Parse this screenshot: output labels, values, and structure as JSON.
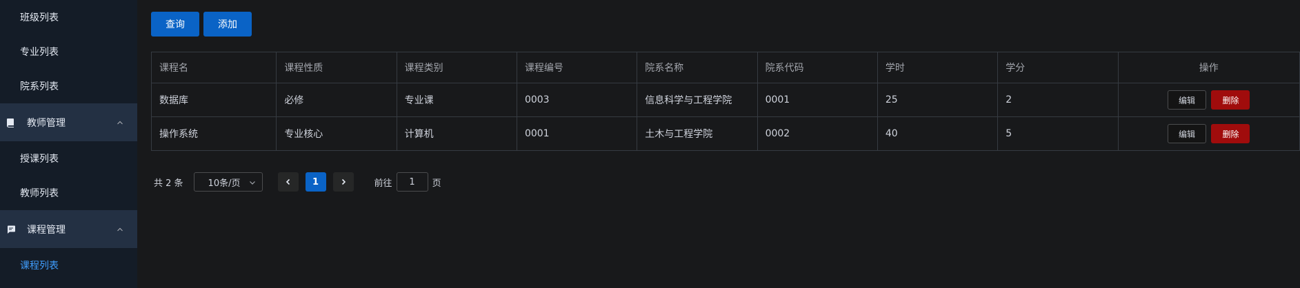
{
  "sidebar": {
    "items": [
      {
        "type": "sub",
        "label": "班级列表",
        "name": "sidebar-item-class-list"
      },
      {
        "type": "sub",
        "label": "专业列表",
        "name": "sidebar-item-major-list"
      },
      {
        "type": "sub",
        "label": "院系列表",
        "name": "sidebar-item-department-list"
      },
      {
        "type": "group",
        "label": "教师管理",
        "icon": "book-icon",
        "name": "sidebar-group-teacher-management"
      },
      {
        "type": "sub",
        "label": "授课列表",
        "name": "sidebar-item-teaching-list"
      },
      {
        "type": "sub",
        "label": "教师列表",
        "name": "sidebar-item-teacher-list"
      },
      {
        "type": "group",
        "label": "课程管理",
        "icon": "comment-icon",
        "name": "sidebar-group-course-management"
      },
      {
        "type": "sub",
        "label": "课程列表",
        "name": "sidebar-item-course-list",
        "active": true
      }
    ]
  },
  "toolbar": {
    "query_label": "查询",
    "add_label": "添加"
  },
  "table": {
    "columns": [
      "课程名",
      "课程性质",
      "课程类别",
      "课程编号",
      "院系名称",
      "院系代码",
      "学时",
      "学分",
      "操作"
    ],
    "rows": [
      [
        "数据库",
        "必修",
        "专业课",
        "0003",
        "信息科学与工程学院",
        "0001",
        "25",
        "2"
      ],
      [
        "操作系统",
        "专业核心",
        "计算机",
        "0001",
        "土木与工程学院",
        "0002",
        "40",
        "5"
      ]
    ],
    "edit_label": "编辑",
    "delete_label": "删除"
  },
  "pagination": {
    "total_text": "共 2 条",
    "page_size": "10条/页",
    "current_page": "1",
    "goto_label": "前往",
    "goto_value": "1",
    "page_suffix": "页"
  },
  "colors": {
    "sidebar_bg": "#141c27",
    "sidebar_group_bg": "#233043",
    "primary": "#0a63c6",
    "danger": "#a00c0c",
    "active_link": "#409eff",
    "page_bg": "#18191b"
  }
}
